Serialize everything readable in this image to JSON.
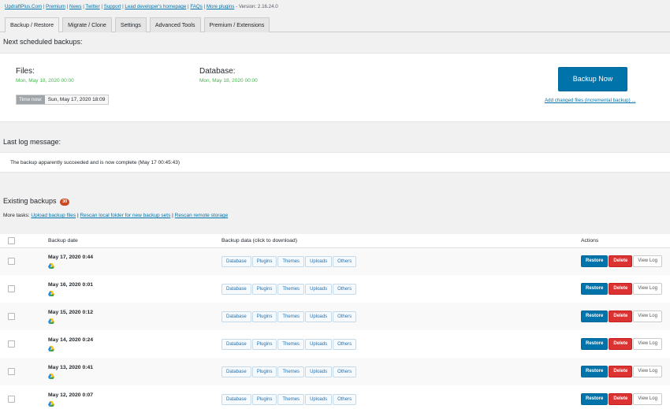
{
  "header": {
    "links": [
      "UpdraftPlus.Com",
      "Premium",
      "News",
      "Twitter",
      "Support",
      "Lead developer's homepage",
      "FAQs",
      "More plugins"
    ],
    "version": "- Version: 2.16.24.0"
  },
  "tabs": [
    {
      "label": "Backup / Restore",
      "active": true
    },
    {
      "label": "Migrate / Clone",
      "active": false
    },
    {
      "label": "Settings",
      "active": false
    },
    {
      "label": "Advanced Tools",
      "active": false
    },
    {
      "label": "Premium / Extensions",
      "active": false
    }
  ],
  "scheduled": {
    "heading": "Next scheduled backups:",
    "files_label": "Files:",
    "files_date": "Mon, May 18, 2020 00:00",
    "database_label": "Database:",
    "database_date": "Mon, May 18, 2020 00:00",
    "time_now_label": "Time now:",
    "time_now_value": "Sun, May 17, 2020 18:09",
    "backup_now_label": "Backup Now",
    "incremental_link": "Add changed files (incremental backup) ..."
  },
  "log": {
    "heading": "Last log message:",
    "message": "The backup apparently succeeded and is now complete (May 17 00:45:43)"
  },
  "existing": {
    "heading": "Existing backups",
    "count": "30",
    "more_tasks_label": "More tasks:",
    "task_links": [
      "Upload backup files",
      "Rescan local folder for new backup sets",
      "Rescan remote storage"
    ]
  },
  "table": {
    "col_date": "Backup date",
    "col_data": "Backup data (click to download)",
    "col_actions": "Actions",
    "data_buttons": [
      "Database",
      "Plugins",
      "Themes",
      "Uploads",
      "Others"
    ],
    "action_restore": "Restore",
    "action_delete": "Delete",
    "action_viewlog": "View Log",
    "rows": [
      {
        "date": "May 17, 2020 0:44"
      },
      {
        "date": "May 16, 2020 0:01"
      },
      {
        "date": "May 15, 2020 0:12"
      },
      {
        "date": "May 14, 2020 0:24"
      },
      {
        "date": "May 13, 2020 0:41"
      },
      {
        "date": "May 12, 2020 0:07"
      }
    ]
  },
  "colors": {
    "primary": "#0073aa",
    "danger": "#dc3232",
    "success": "#46b450",
    "badge": "#ca4a1f"
  },
  "icons": {
    "remote_storage": "google-drive-icon"
  }
}
